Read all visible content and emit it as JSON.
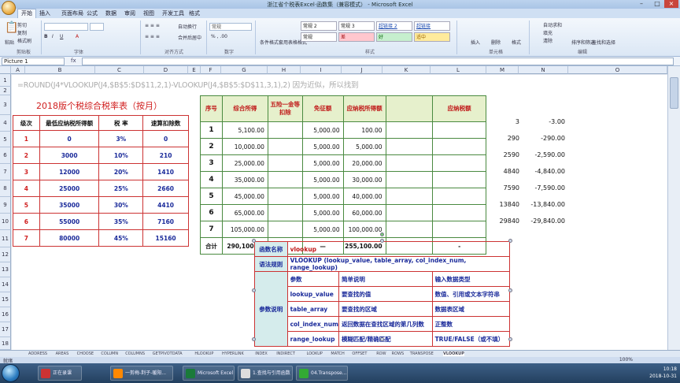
{
  "window": {
    "title": "浙江省个税表Excel·函数集（兼容模式） - Microsoft Excel"
  },
  "ribbon": {
    "tabs": [
      "开始",
      "插入",
      "页面布局",
      "公式",
      "数据",
      "审阅",
      "视图",
      "开发工具",
      "格式"
    ],
    "groups": [
      "剪贴板",
      "字体",
      "对齐方式",
      "数字",
      "样式",
      "单元格",
      "编辑"
    ],
    "paste": "粘贴",
    "cut": "剪切",
    "copy": "复制",
    "format_painter": "格式刷",
    "wrap_text": "自动换行",
    "merge_center": "合并后居中",
    "number_format": "常规",
    "styles": [
      "常规 2",
      "常规 3",
      "超链接 2",
      "超链接"
    ],
    "styles2": [
      "常规",
      "差",
      "好",
      "适中"
    ],
    "cond_format": "条件格式",
    "table_format": "套用表格格式",
    "insert": "插入",
    "delete": "删除",
    "format": "格式",
    "autosum": "自动求和",
    "fill": "填充",
    "clear": "清除",
    "sort_filter": "排序和筛选",
    "find_select": "查找和选择"
  },
  "formula_bar": {
    "name_box": "Picture 1",
    "fx": "fx",
    "value": ""
  },
  "columns": [
    "A",
    "B",
    "C",
    "D",
    "E",
    "F",
    "G",
    "H",
    "I",
    "J",
    "K",
    "L",
    "M",
    "N",
    "O"
  ],
  "rows": [
    "1",
    "2",
    "3",
    "4",
    "5",
    "6",
    "7",
    "8",
    "9",
    "10",
    "11",
    "12",
    "13",
    "14",
    "15",
    "16",
    "17",
    "18",
    "19",
    "20",
    "21",
    "22"
  ],
  "formula_note": "=ROUND(J4*VLOOKUP(J4,$B$5:$D$11,2,1)-VLOOKUP(J4,$B$5:$D$11,3,1),2) 因为近似，所以找到",
  "rate_table": {
    "title": "2018版个税综合税率表（按月）",
    "headers": [
      "级次",
      "最低应纳税所得额",
      "税 率",
      "速算扣除数"
    ],
    "rows": [
      [
        "1",
        "0",
        "3%",
        "0"
      ],
      [
        "2",
        "3000",
        "10%",
        "210"
      ],
      [
        "3",
        "12000",
        "20%",
        "1410"
      ],
      [
        "4",
        "25000",
        "25%",
        "2660"
      ],
      [
        "5",
        "35000",
        "30%",
        "4410"
      ],
      [
        "6",
        "55000",
        "35%",
        "7160"
      ],
      [
        "7",
        "80000",
        "45%",
        "15160"
      ]
    ]
  },
  "calc_table": {
    "headers": [
      "序号",
      "综合所得",
      "五险一金等扣除",
      "免征额",
      "应纳税所得额",
      "",
      "应纳税额"
    ],
    "rows": [
      [
        "1",
        "5,100.00",
        "",
        "5,000.00",
        "100.00",
        "",
        ""
      ],
      [
        "2",
        "10,000.00",
        "",
        "5,000.00",
        "5,000.00",
        "",
        ""
      ],
      [
        "3",
        "25,000.00",
        "",
        "5,000.00",
        "20,000.00",
        "",
        ""
      ],
      [
        "4",
        "35,000.00",
        "",
        "5,000.00",
        "30,000.00",
        "",
        ""
      ],
      [
        "5",
        "45,000.00",
        "",
        "5,000.00",
        "40,000.00",
        "",
        ""
      ],
      [
        "6",
        "65,000.00",
        "",
        "5,000.00",
        "60,000.00",
        "",
        ""
      ],
      [
        "7",
        "105,000.00",
        "",
        "5,000.00",
        "100,000.00",
        "",
        ""
      ]
    ],
    "total": [
      "合计",
      "290,100.00",
      "-",
      "—",
      "255,100.00",
      "",
      "-"
    ]
  },
  "side_values": [
    [
      "3",
      "-3.00"
    ],
    [
      "290",
      "-290.00"
    ],
    [
      "2590",
      "-2,590.00"
    ],
    [
      "4840",
      "-4,840.00"
    ],
    [
      "7590",
      "-7,590.00"
    ],
    [
      "13840",
      "-13,840.00"
    ],
    [
      "29840",
      "-29,840.00"
    ]
  ],
  "help_table": {
    "func_label": "函数名称",
    "func_name": "vlookup",
    "syntax_label": "语法规则",
    "syntax": "VLOOKUP (lookup_value, table_array, col_index_num, range_lookup)",
    "param_label": "参数说明",
    "params": [
      [
        "参数",
        "简单说明",
        "输入数据类型"
      ],
      [
        "lookup_value",
        "要查找的值",
        "数值、引用或文本字符串"
      ],
      [
        "table_array",
        "要查找的区域",
        "数据表区域"
      ],
      [
        "col_index_num",
        "返回数据在查找区域的第几列数",
        "正整数"
      ],
      [
        "range_lookup",
        "模糊匹配/精确匹配",
        "TRUE/FALSE（或不填）"
      ]
    ]
  },
  "sheet_tabs": [
    "ADDRESS",
    "AREAS",
    "CHOOSE",
    "COLUMN",
    "COLUMNS",
    "GETPIVOTDATA",
    "HLOOKUP",
    "HYPERLINK",
    "INDEX",
    "INDIRECT",
    "LOOKUP",
    "MATCH",
    "OFFSET",
    "ROW",
    "ROWS",
    "TRANSPOSE",
    "VLOOKUP"
  ],
  "status": {
    "left": "就绪",
    "zoom": "100%"
  },
  "taskbar": {
    "items": [
      "正在录课",
      "一剪梅-荆子-暖阳...",
      "",
      "Microsoft Excel ...",
      "1.查找与引用函数",
      "04.Transpose..."
    ],
    "time": "10:18",
    "date": "2018-10-31"
  },
  "colors": {
    "red": "#d01e1e",
    "blue": "#1a2a9a",
    "green_border": "#4a8a40",
    "header_green": "#e6f0cc",
    "label_teal": "#d5ecec"
  }
}
